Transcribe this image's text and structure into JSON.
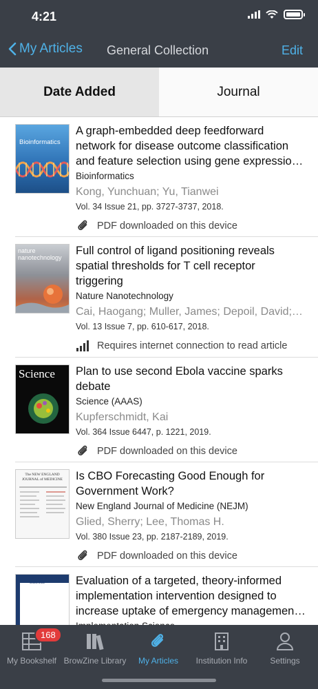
{
  "status": {
    "time": "4:21"
  },
  "nav": {
    "back_label": "My Articles",
    "title": "General Collection",
    "edit_label": "Edit"
  },
  "segments": [
    {
      "label": "Date Added"
    },
    {
      "label": "Journal"
    }
  ],
  "articles": [
    {
      "title": "A graph-embedded deep feedforward network for disease outcome classification and feature selection using gene expression data",
      "journal": "Bioinformatics",
      "authors": "Kong, Yunchuan; Yu, Tianwei",
      "citation": "Vol. 34 Issue 21, pp. 3727-3737, 2018.",
      "status": "PDF downloaded on this device",
      "status_icon": "paperclip-icon",
      "cover_text": "Bioinformatics",
      "cover_color": "#3b84c6"
    },
    {
      "title": "Full control of ligand positioning reveals spatial thresholds for T cell receptor triggering",
      "journal": "Nature Nanotechnology",
      "authors": "Cai, Haogang; Muller, James; Depoil, David; et al.",
      "citation": "Vol. 13 Issue 7, pp. 610-617, 2018.",
      "status": "Requires internet connection to read article",
      "status_icon": "signal-icon",
      "cover_text": "nature nanotechnology",
      "cover_color": "#8a8f98"
    },
    {
      "title": "Plan to use second Ebola vaccine sparks debate",
      "journal": "Science (AAAS)",
      "authors": "Kupferschmidt, Kai",
      "citation": "Vol. 364 Issue 6447, p. 1221, 2019.",
      "status": "PDF downloaded on this device",
      "status_icon": "paperclip-icon",
      "cover_text": "Science",
      "cover_color": "#0a0a0a"
    },
    {
      "title": "Is CBO Forecasting Good Enough for Government Work?",
      "journal": "New England Journal of Medicine (NEJM)",
      "authors": "Glied, Sherry; Lee, Thomas H.",
      "citation": "Vol. 380 Issue 23, pp. 2187-2189, 2019.",
      "status": "PDF downloaded on this device",
      "status_icon": "paperclip-icon",
      "cover_text": "The NEW ENGLAND JOURNAL of MEDICINE",
      "cover_color": "#f5f5f5"
    },
    {
      "title": "Evaluation of a targeted, theory-informed implementation intervention designed to increase uptake of emergency management recommendations",
      "journal": "Implementation Science",
      "authors": "",
      "citation": "",
      "status": "",
      "status_icon": "",
      "cover_text": "IMPLEMENTATION SCIENCE",
      "cover_color": "#ffffff"
    }
  ],
  "tabs": [
    {
      "label": "My Bookshelf",
      "badge": "168",
      "icon": "bookshelf-icon"
    },
    {
      "label": "BrowZine Library",
      "icon": "library-icon"
    },
    {
      "label": "My Articles",
      "icon": "paperclip-icon"
    },
    {
      "label": "Institution Info",
      "icon": "building-icon"
    },
    {
      "label": "Settings",
      "icon": "person-icon"
    }
  ],
  "colors": {
    "accent": "#4fb2e8",
    "bar_bg": "#3a3f47",
    "badge": "#e23b3b"
  }
}
